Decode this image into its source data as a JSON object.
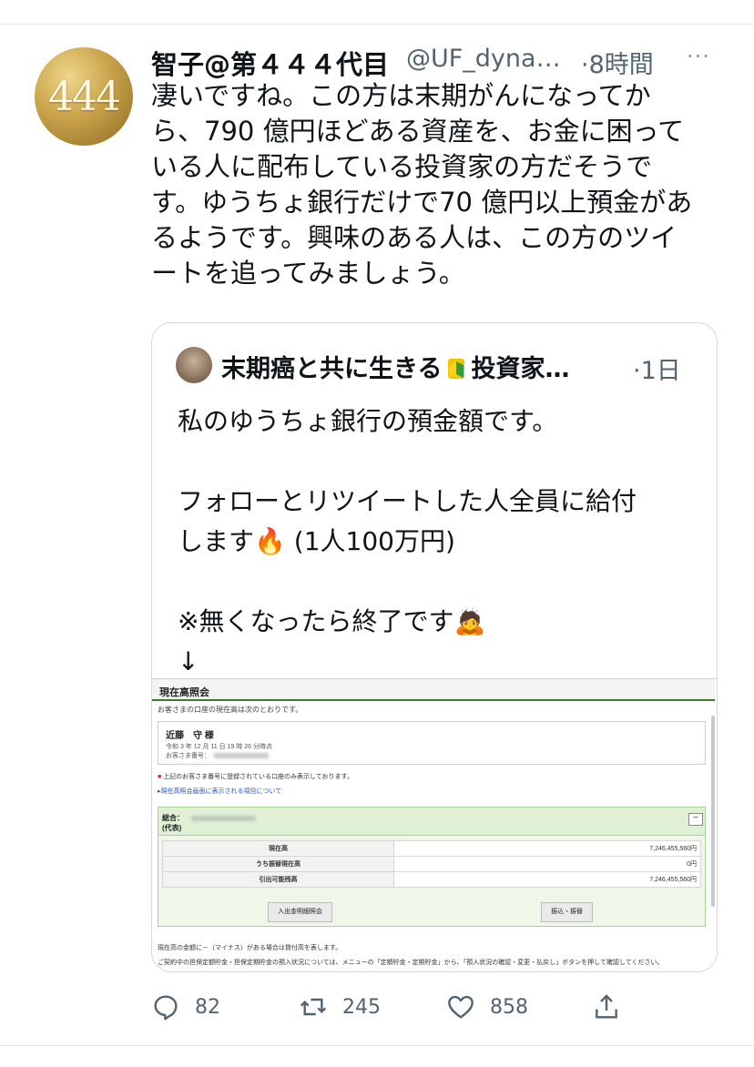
{
  "tweet": {
    "avatar_text": "444",
    "display_name": "智子@第４４４代目",
    "handle": "@UF_dyna…",
    "time": "·8時間",
    "more": "···",
    "text_lines": [
      "凄いですね。この方は末期がんになってか",
      "ら、790 億円ほどある資産を、お金に困って",
      "いる人に配布している投資家の方だそうで",
      "す。ゆうちょ銀行だけで70 億円以上預金があ",
      "るようです。興味のある人は、この方のツイ",
      "ートを追ってみましょう。"
    ]
  },
  "quote": {
    "name_before_badge": "末期癌と共に生きる",
    "name_after_badge": "投資家…",
    "time": "·1日",
    "text_lines": [
      "私のゆうちょ銀行の預金額です。",
      "",
      "フォローとリツイートした人全員に給付",
      "します🔥 (1人100万円)",
      "",
      "※無くなったら終了です🙇",
      "↓"
    ]
  },
  "bank": {
    "title": "現在高照会",
    "desc": "お客さまの口座の現在高は次のとおりです。",
    "customer_name": "近藤　守 様",
    "date_line": "令和 3 年 12 月 11 日 19 時 26 分時点",
    "account_label": "お客さま番号：",
    "note": "上記のお客さま番号に登録されている口座のみ表示しております。",
    "link": "▸現在高照会画面に表示される項目について",
    "panel_label_1": "総合：",
    "panel_label_2": "(代表)",
    "collapse": "−",
    "rows": [
      {
        "label": "現在高",
        "value": "7,246,455,560円"
      },
      {
        "label": "うち振替現在高",
        "value": "0円"
      },
      {
        "label": "引出可能残高",
        "value": "7,246,455,560円"
      }
    ],
    "btn_history": "入出金明細照会",
    "btn_transfer": "振込・振替",
    "foot1": "現在高の金額に－（マイナス）がある場合は貸付高を表します。",
    "foot2": "ご契約中の担保定額貯金・担保定期貯金の預入状況については、メニューの「定額貯金・定期貯金」から、「預入状況の確認・変更・払戻し」ボタンを押して確認してください。"
  },
  "actions": {
    "reply_count": "82",
    "retweet_count": "245",
    "like_count": "858"
  },
  "icons": [
    "more-icon",
    "beginner-badge-icon",
    "reply-icon",
    "retweet-icon",
    "like-icon",
    "share-icon"
  ],
  "colors": {
    "text": "#0f1419",
    "secondary": "#536471",
    "border": "#cfd9de",
    "bank_green": "#3a7d2b",
    "avatar_gold": "#c9a24a"
  }
}
